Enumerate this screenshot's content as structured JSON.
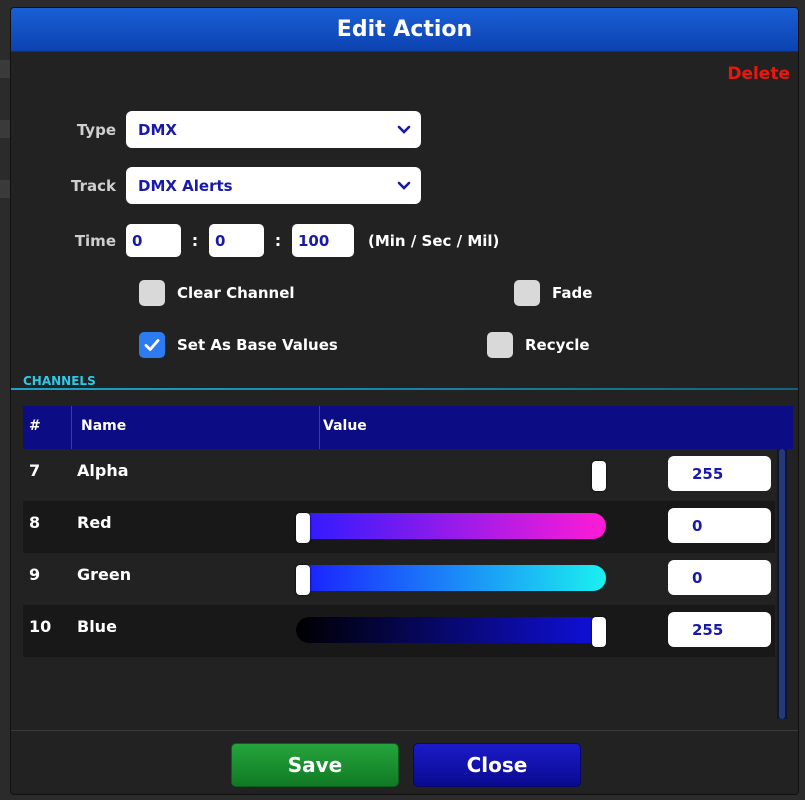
{
  "dialog": {
    "title": "Edit Action",
    "delete_label": "Delete"
  },
  "form": {
    "type_label": "Type",
    "type_value": "DMX",
    "track_label": "Track",
    "track_value": "DMX Alerts",
    "time_label": "Time",
    "time_min": "0",
    "time_sec": "0",
    "time_mil": "100",
    "time_sep": ":",
    "time_hint": "(Min / Sec / Mil)"
  },
  "options": {
    "clear_channel": {
      "label": "Clear Channel",
      "checked": false
    },
    "fade": {
      "label": "Fade",
      "checked": false
    },
    "set_base": {
      "label": "Set As Base Values",
      "checked": true
    },
    "recycle": {
      "label": "Recycle",
      "checked": false
    }
  },
  "channels": {
    "heading": "CHANNELS",
    "columns": {
      "num": "#",
      "name": "Name",
      "value": "Value"
    },
    "rows": [
      {
        "num": "7",
        "name": "Alpha",
        "value": "255",
        "level": 1.0,
        "gradient": "none"
      },
      {
        "num": "8",
        "name": "Red",
        "value": "0",
        "level": 0.0,
        "gradient": "linear-gradient(90deg,#2a1bff,#ff1bd6)"
      },
      {
        "num": "9",
        "name": "Green",
        "value": "0",
        "level": 0.0,
        "gradient": "linear-gradient(90deg,#1b1bff,#1bf0f0)"
      },
      {
        "num": "10",
        "name": "Blue",
        "value": "255",
        "level": 1.0,
        "gradient": "linear-gradient(90deg,#000000,#1010e0)"
      }
    ]
  },
  "footer": {
    "save_label": "Save",
    "close_label": "Close"
  },
  "colors": {
    "title_bar": "#1a5fd6",
    "delete": "#e8180c",
    "table_header": "#0c0c85",
    "save": "#1f9a34",
    "close": "#1414b8",
    "checkbox_on": "#2d7bf0"
  }
}
